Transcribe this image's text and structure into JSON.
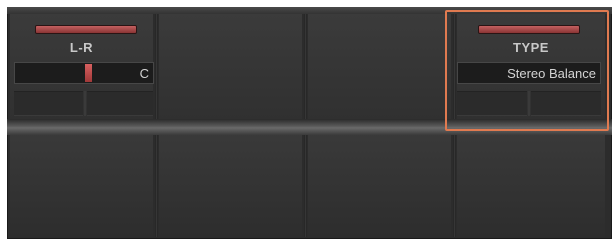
{
  "channels": [
    {
      "label": "L-R",
      "value": "C",
      "marker_position": 0.55
    },
    {
      "label": "",
      "value": ""
    },
    {
      "label": "",
      "value": ""
    },
    {
      "label": "TYPE",
      "value": "Stereo Balance"
    }
  ],
  "highlight_color": "#e07a50",
  "accent_red": "#b04848"
}
